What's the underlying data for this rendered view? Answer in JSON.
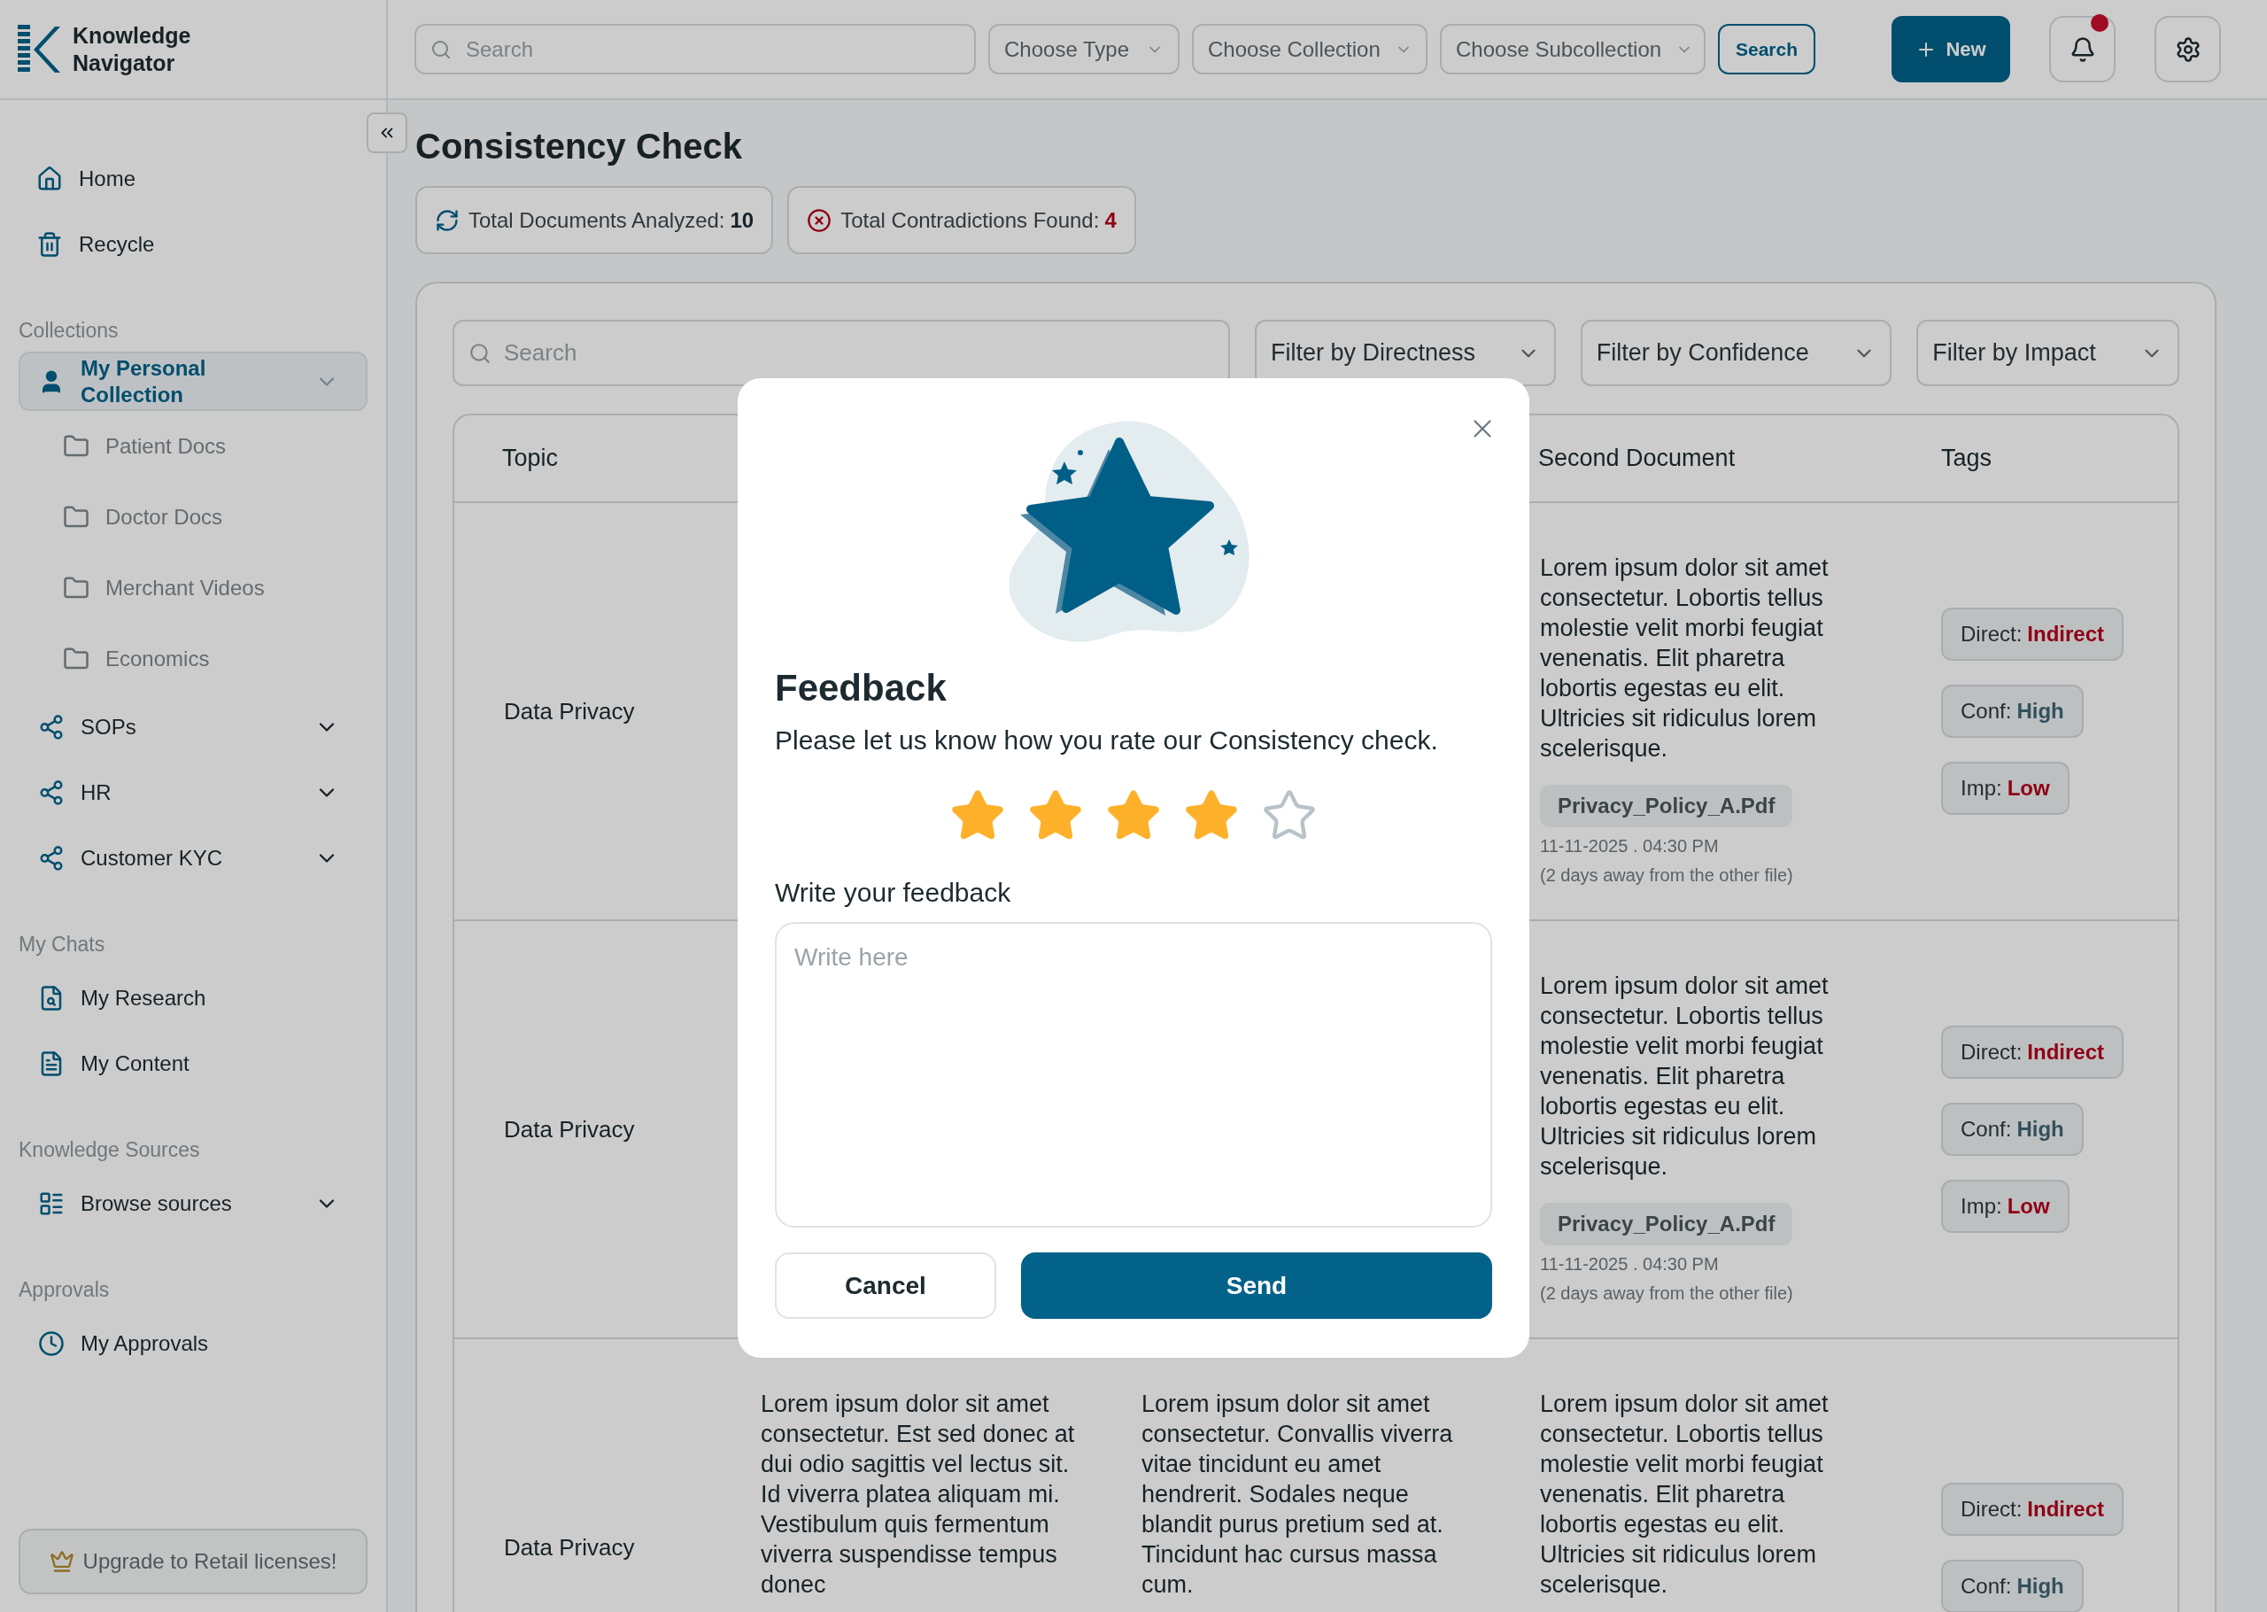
{
  "header": {
    "app_name": "Knowledge Navigator",
    "search": {
      "placeholder": "Search"
    },
    "dropdowns": [
      {
        "placeholder": "Choose Type"
      },
      {
        "placeholder": "Choose Collection"
      },
      {
        "placeholder": "Choose Subcollection"
      }
    ],
    "search_button": "Search",
    "new_button": "New",
    "notifications": {
      "unread": true
    }
  },
  "sidebar": {
    "nav": [
      {
        "label": "Home",
        "selected": false
      },
      {
        "label": "Recycle",
        "selected": false
      }
    ],
    "sections": [
      {
        "title": "Collections",
        "kind": "collections",
        "items": [
          {
            "label": "My Personal Collection",
            "selected": true,
            "expanded": true,
            "children": [
              {
                "label": "Patient Docs"
              },
              {
                "label": "Doctor Docs"
              },
              {
                "label": "Merchant Videos"
              },
              {
                "label": "Economics"
              }
            ]
          },
          {
            "label": "SOPs",
            "selected": false,
            "expanded": false
          },
          {
            "label": "HR",
            "selected": false,
            "expanded": false
          },
          {
            "label": "Customer KYC",
            "selected": false,
            "expanded": false
          }
        ]
      },
      {
        "title": "My Chats",
        "kind": "chats",
        "items": [
          {
            "label": "My Research",
            "selected": false
          },
          {
            "label": "My Content",
            "selected": false
          }
        ]
      },
      {
        "title": "Knowledge Sources",
        "kind": "sources",
        "items": [
          {
            "label": "Browse sources",
            "selected": false,
            "expanded": false
          }
        ]
      },
      {
        "title": "Approvals",
        "kind": "approvals",
        "items": [
          {
            "label": "My Approvals",
            "selected": false
          }
        ]
      }
    ],
    "upgrade": "Upgrade to Retail licenses!"
  },
  "page": {
    "title": "Consistency Check",
    "stats": [
      {
        "kind": "analyzed",
        "label": "Total Documents Analyzed:",
        "value": "10"
      },
      {
        "kind": "contradictions",
        "label": "Total Contradictions Found:",
        "value": "4"
      }
    ],
    "search": {
      "placeholder": "Search"
    },
    "filters": [
      "Filter by Directness",
      "Filter by Confidence",
      "Filter by Impact"
    ],
    "table": {
      "columns": {
        "topic": "Topic",
        "second_document": "Second Document",
        "tags": "Tags"
      },
      "rows": [
        {
          "topic": "Data Privacy",
          "second_document": {
            "text": "Lorem ipsum dolor sit amet consectetur. Lobortis tellus molestie velit morbi feugiat venenatis. Elit pharetra lobortis egestas eu elit. Ultricies sit ridiculus lorem scelerisque.",
            "file": "Privacy_Policy_A.Pdf",
            "date": "11-11-2025 . 04:30 PM",
            "note": "(2 days away from the other file)"
          },
          "tags": [
            {
              "label": "Direct:",
              "value": "Indirect",
              "kind": "negative"
            },
            {
              "label": "Conf:",
              "value": "High",
              "kind": "neutral"
            },
            {
              "label": "Imp:",
              "value": "Low",
              "kind": "negative"
            }
          ]
        },
        {
          "topic": "Data Privacy",
          "second_document": {
            "text": "Lorem ipsum dolor sit amet consectetur. Lobortis tellus molestie velit morbi feugiat venenatis. Elit pharetra lobortis egestas eu elit. Ultricies sit ridiculus lorem scelerisque.",
            "file": "Privacy_Policy_A.Pdf",
            "date": "11-11-2025 . 04:30 PM",
            "note": "(2 days away from the other file)"
          },
          "tags": [
            {
              "label": "Direct:",
              "value": "Indirect",
              "kind": "negative"
            },
            {
              "label": "Conf:",
              "value": "High",
              "kind": "neutral"
            },
            {
              "label": "Imp:",
              "value": "Low",
              "kind": "negative"
            }
          ]
        },
        {
          "topic": "Data Privacy",
          "column_2": "Lorem ipsum dolor sit amet consectetur. Est sed donec at dui odio sagittis vel lectus sit. Id viverra platea aliquam mi. Vestibulum quis fermentum viverra suspendisse tempus donec",
          "column_3": "Lorem ipsum dolor sit amet consectetur. Convallis viverra vitae tincidunt eu amet hendrerit. Sodales neque blandit purus pretium sed at. Tincidunt hac cursus massa cum.",
          "second_document": {
            "text": "Lorem ipsum dolor sit amet consectetur. Lobortis tellus molestie velit morbi feugiat venenatis. Elit pharetra lobortis egestas eu elit. Ultricies sit ridiculus lorem scelerisque."
          },
          "tags": [
            {
              "label": "Direct:",
              "value": "Indirect",
              "kind": "negative"
            },
            {
              "label": "Conf:",
              "value": "High",
              "kind": "neutral"
            }
          ]
        }
      ]
    }
  },
  "modal": {
    "title": "Feedback",
    "message": "Please let us know how you rate our Consistency check.",
    "stars": 4,
    "label": "Write your feedback",
    "placeholder": "Write here",
    "cancel": "Cancel",
    "send": "Send"
  }
}
